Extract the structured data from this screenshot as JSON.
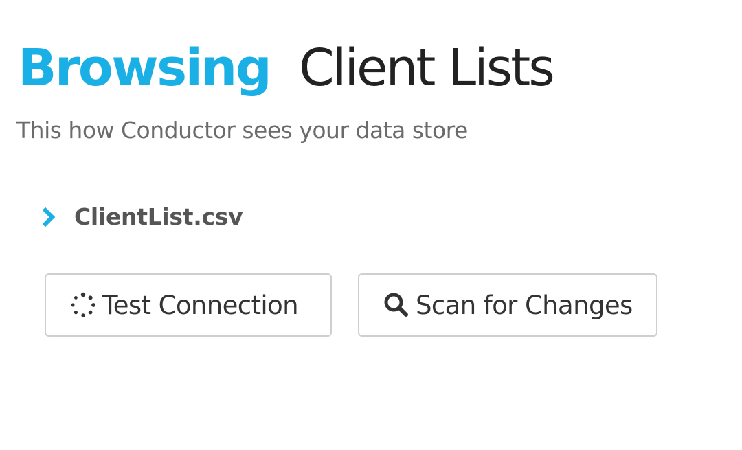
{
  "header": {
    "title_accent": "Browsing",
    "title_main": "Client Lists",
    "subtitle": "This how Conductor sees your data store",
    "accent_color": "#1ab0e6"
  },
  "tree": {
    "items": [
      {
        "label": "ClientList.csv",
        "icon": "chevron-right-icon",
        "expanded": false
      }
    ]
  },
  "actions": {
    "test_connection": {
      "label": "Test Connection",
      "icon": "spinner-icon"
    },
    "scan_for_changes": {
      "label": "Scan for Changes",
      "icon": "search-icon"
    }
  }
}
